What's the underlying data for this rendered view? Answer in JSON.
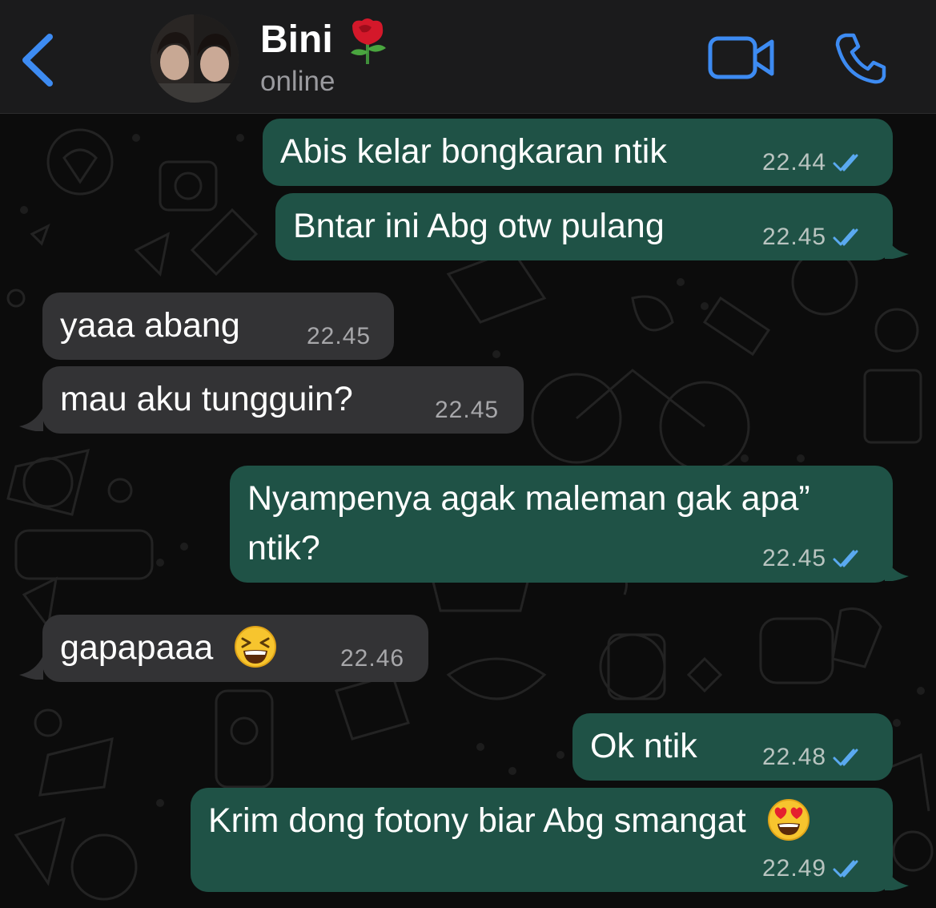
{
  "header": {
    "contact_name": "Bini",
    "contact_status": "online",
    "icons": [
      "back-chevron-icon",
      "rose-emoji-icon",
      "video-call-icon",
      "phone-call-icon"
    ],
    "accent_color": "#3d8bf2"
  },
  "messages": [
    {
      "direction": "outgoing",
      "text": "Abis kelar bongkaran ntik",
      "time": "22.44",
      "status": "read"
    },
    {
      "direction": "outgoing",
      "text": "Bntar ini Abg otw pulang",
      "time": "22.45",
      "status": "read"
    },
    {
      "direction": "incoming",
      "text": "yaaa abang",
      "time": "22.45"
    },
    {
      "direction": "incoming",
      "text": "mau aku tungguin?",
      "time": "22.45"
    },
    {
      "direction": "outgoing",
      "text_line1": "Nyampenya agak maleman gak apa”",
      "text_line2": "ntik?",
      "time": "22.45",
      "status": "read"
    },
    {
      "direction": "incoming",
      "text": "gapapaaa",
      "emoji": "grinning-squinting-face-emoji",
      "time": "22.46"
    },
    {
      "direction": "outgoing",
      "text": "Ok ntik",
      "time": "22.48",
      "status": "read"
    },
    {
      "direction": "outgoing",
      "text": "Krim dong fotony biar Abg smangat",
      "emoji": "heart-eyes-emoji",
      "time": "22.49",
      "status": "read"
    }
  ],
  "colors": {
    "outgoing_bubble": "#1f5246",
    "incoming_bubble": "#333335",
    "read_ticks": "#5aa9f0"
  }
}
